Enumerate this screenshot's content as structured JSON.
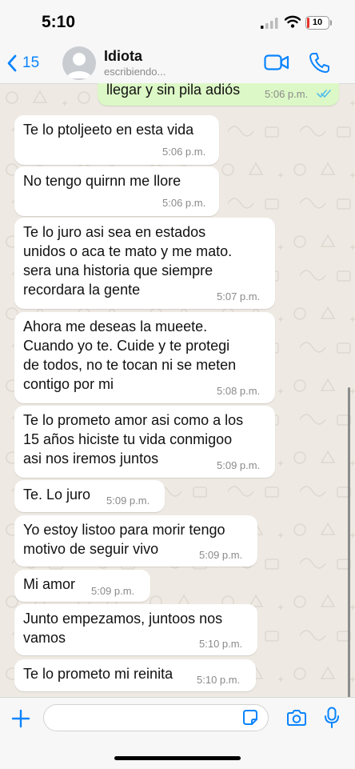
{
  "status_bar": {
    "time": "5:10",
    "battery": "10"
  },
  "header": {
    "back_count": "15",
    "contact_name": "Idiota",
    "contact_status": "escribiendo..."
  },
  "messages": [
    {
      "direction": "outgoing",
      "text": "llegar y sin pila adiós",
      "time": "5:06 p.m.",
      "read": true
    },
    {
      "direction": "incoming",
      "text": "Te lo ptoljeeto en esta vida",
      "time": "5:06 p.m."
    },
    {
      "direction": "incoming",
      "text": "No tengo quirnn me llore",
      "time": "5:06 p.m."
    },
    {
      "direction": "incoming",
      "text": "Te lo juro asi sea en estados\nunidos o aca te mato y me mato.\nsera una historia que siempre\nrecordara la gente",
      "time": "5:07 p.m."
    },
    {
      "direction": "incoming",
      "text": "Ahora me deseas la mueete.\nCuando yo te. Cuide y te protegi\nde todos, no te tocan ni se meten\ncontigo por mi",
      "time": "5:08 p.m."
    },
    {
      "direction": "incoming",
      "text": "Te lo prometo amor asi como a los\n15 años hiciste tu vida conmigoo\nasi nos iremos juntos",
      "time": "5:09 p.m."
    },
    {
      "direction": "incoming",
      "text": "Te. Lo juro",
      "time": "5:09 p.m."
    },
    {
      "direction": "incoming",
      "text": "Yo estoy listoo para morir tengo\nmotivo de seguir vivo",
      "time": "5:09 p.m."
    },
    {
      "direction": "incoming",
      "text": "Mi amor",
      "time": "5:09 p.m."
    },
    {
      "direction": "incoming",
      "text": "Junto empezamos, juntoos nos\nvamos",
      "time": "5:10 p.m."
    },
    {
      "direction": "incoming",
      "text": "Te lo prometo mi reinita",
      "time": "5:10 p.m."
    }
  ],
  "composer": {
    "value": ""
  },
  "colors": {
    "accent": "#0a84ff",
    "outgoing_bubble": "#dcf8c6",
    "incoming_bubble": "#ffffff",
    "read_ticks": "#53bdeb"
  }
}
